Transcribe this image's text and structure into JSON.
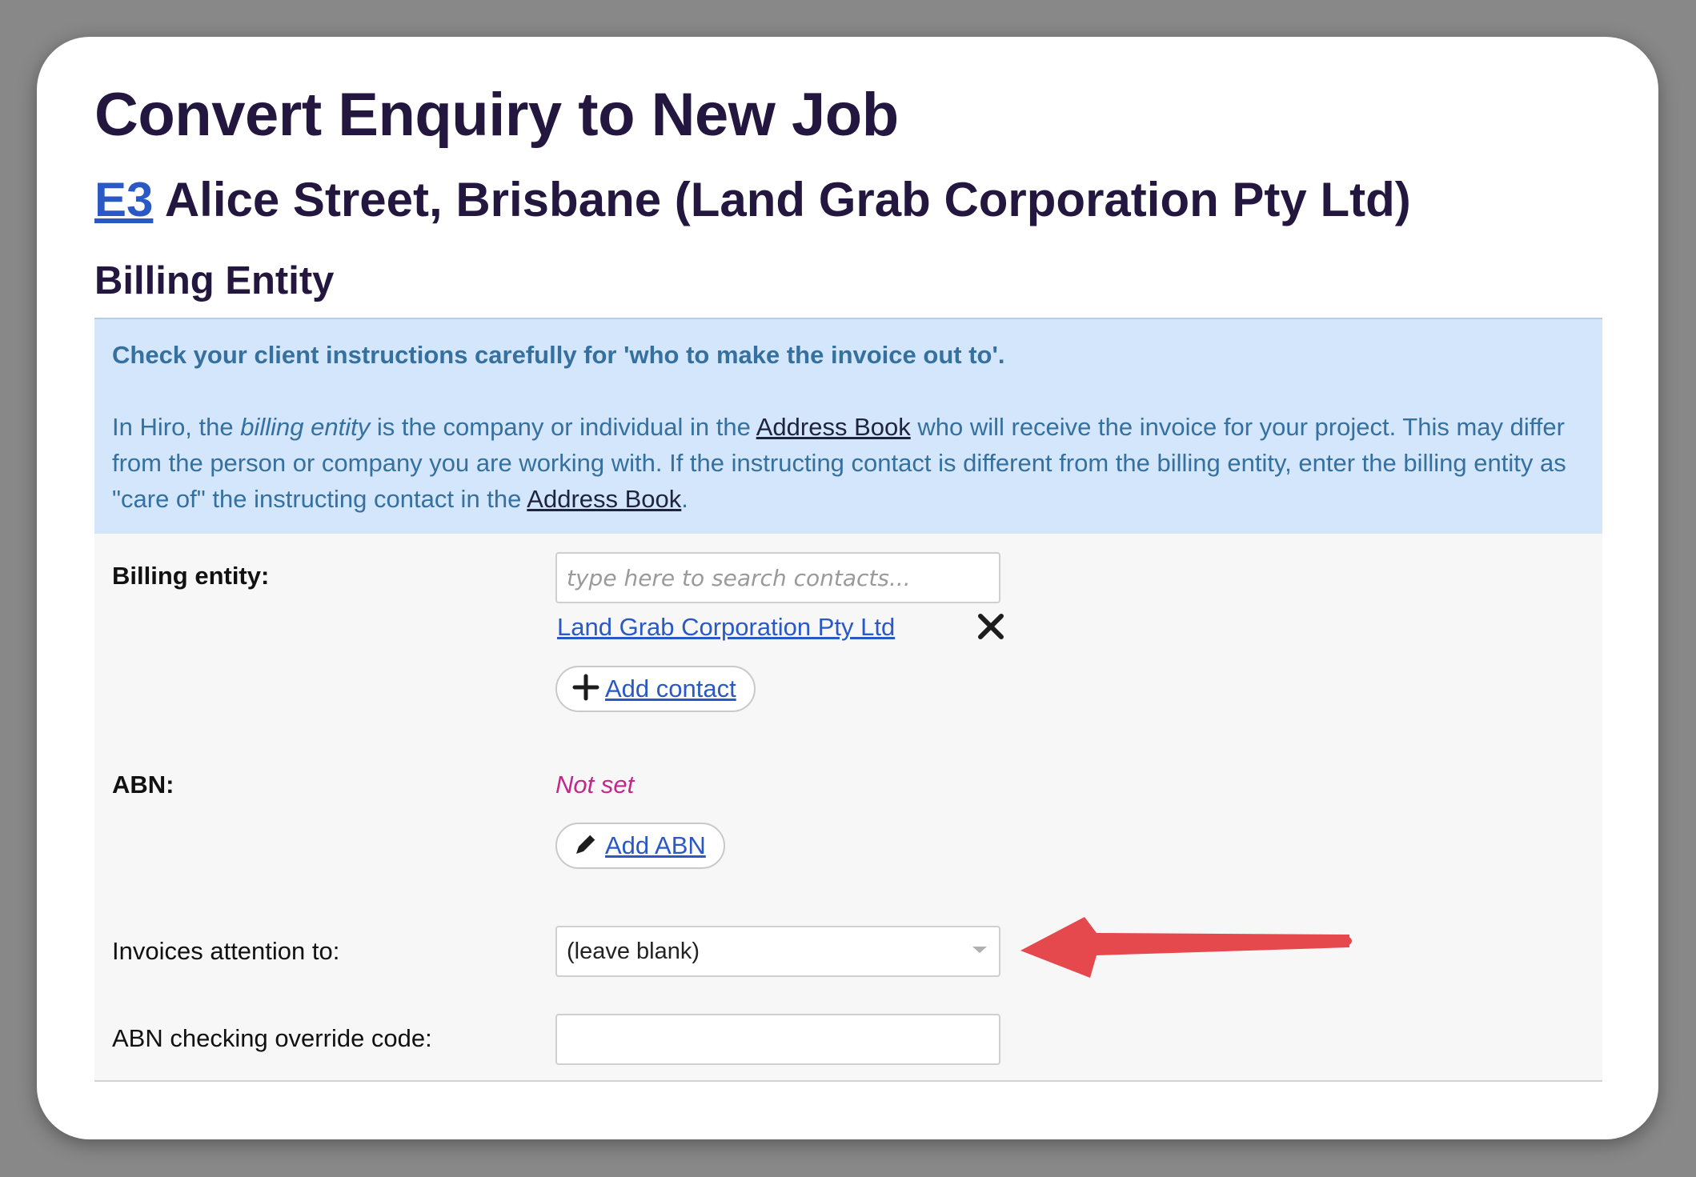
{
  "page": {
    "title": "Convert Enquiry to New Job",
    "job_ref": "E3",
    "job_desc": "Alice Street, Brisbane (Land Grab Corporation Pty Ltd)"
  },
  "billing": {
    "section_title": "Billing Entity",
    "info": {
      "lead": "Check your client instructions carefully for 'who to make the invoice out to'.",
      "p1": "In Hiro, the ",
      "p_italic": "billing entity",
      "p2": " is the company or individual in the ",
      "address_book_1": "Address Book",
      "p3": " who will receive the invoice for your project. This may differ from the person or company you are working with. If the instructing contact is different from the billing entity, enter the billing entity as \"care of\" the instructing contact in the ",
      "address_book_2": "Address Book",
      "p4": "."
    },
    "form": {
      "billing_entity_label": "Billing entity:",
      "search_placeholder": "type here to search contacts...",
      "selected_contact": "Land Grab Corporation Pty Ltd",
      "add_contact_label": "Add contact",
      "abn_label": "ABN:",
      "abn_value": "Not set",
      "add_abn_label": "Add ABN",
      "invoices_attention_label": "Invoices attention to:",
      "invoices_attention_value": "(leave blank)",
      "abn_override_label": "ABN checking override code:",
      "abn_override_value": ""
    }
  },
  "icons": {
    "remove": "close-icon",
    "add": "plus-icon",
    "edit": "pencil-icon",
    "dropdown": "chevron-down-icon",
    "annotation": "red-arrow-icon"
  },
  "colors": {
    "heading": "#23173f",
    "link": "#2a58c4",
    "info_bg": "#d3e6fb",
    "info_text": "#35709f",
    "not_set": "#c2288a",
    "annotation_arrow": "#e5484d"
  }
}
